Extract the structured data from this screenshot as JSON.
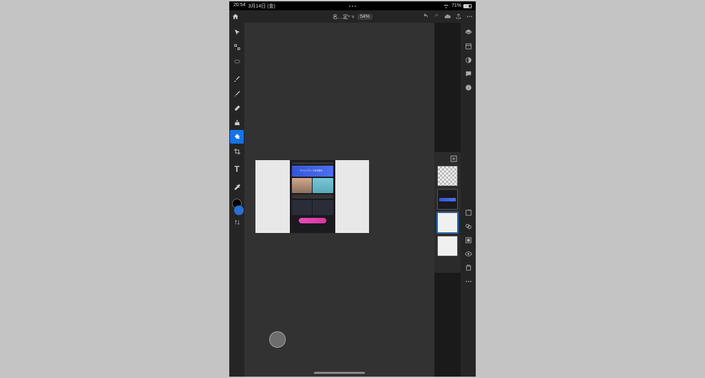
{
  "status": {
    "time": "20:54",
    "date": "3月14日 (金)",
    "wifi_icon": "wifi-icon",
    "battery_pct": "71%"
  },
  "app": {
    "home_icon": "home-icon",
    "doc_title": "名…定* ˅",
    "zoom": "54%",
    "icons": {
      "undo": "undo-icon",
      "redo": "redo-icon",
      "cloud": "cloud-icon",
      "share": "share-icon",
      "more": "more-icon"
    }
  },
  "left_tools": [
    {
      "name": "move-tool",
      "active": false
    },
    {
      "name": "lasso-tool",
      "active": false
    },
    {
      "name": "selection-brush-tool",
      "active": false
    },
    {
      "name": "brush-tool",
      "active": false
    },
    {
      "name": "spot-heal-tool",
      "active": false
    },
    {
      "name": "eraser-tool",
      "active": false
    },
    {
      "name": "clone-stamp-tool",
      "active": false
    },
    {
      "name": "fill-tool",
      "active": true
    },
    {
      "name": "crop-tool",
      "active": false
    },
    {
      "name": "type-tool",
      "active": false
    },
    {
      "name": "eyedropper-tool",
      "active": false
    }
  ],
  "right_tools_top": [
    {
      "name": "layers-panel-icon"
    },
    {
      "name": "layer-properties-icon"
    },
    {
      "name": "adjustments-icon"
    },
    {
      "name": "comments-icon"
    },
    {
      "name": "info-icon"
    }
  ],
  "right_tools_mid": [
    {
      "name": "export-icon"
    },
    {
      "name": "filters-icon"
    },
    {
      "name": "mask-icon"
    },
    {
      "name": "visibility-icon"
    },
    {
      "name": "trash-icon"
    },
    {
      "name": "overflow-icon"
    }
  ],
  "layers": {
    "add_label": "add-layer-icon",
    "items": [
      {
        "name": "layer-4",
        "style": "checker"
      },
      {
        "name": "layer-3",
        "style": "dark"
      },
      {
        "name": "layer-2",
        "style": "light",
        "selected": true
      },
      {
        "name": "layer-1",
        "style": "light"
      }
    ]
  },
  "canvas": {
    "banner_text": "クリエイティブな作品を…",
    "pill_text": ""
  },
  "type_glyph": "T"
}
